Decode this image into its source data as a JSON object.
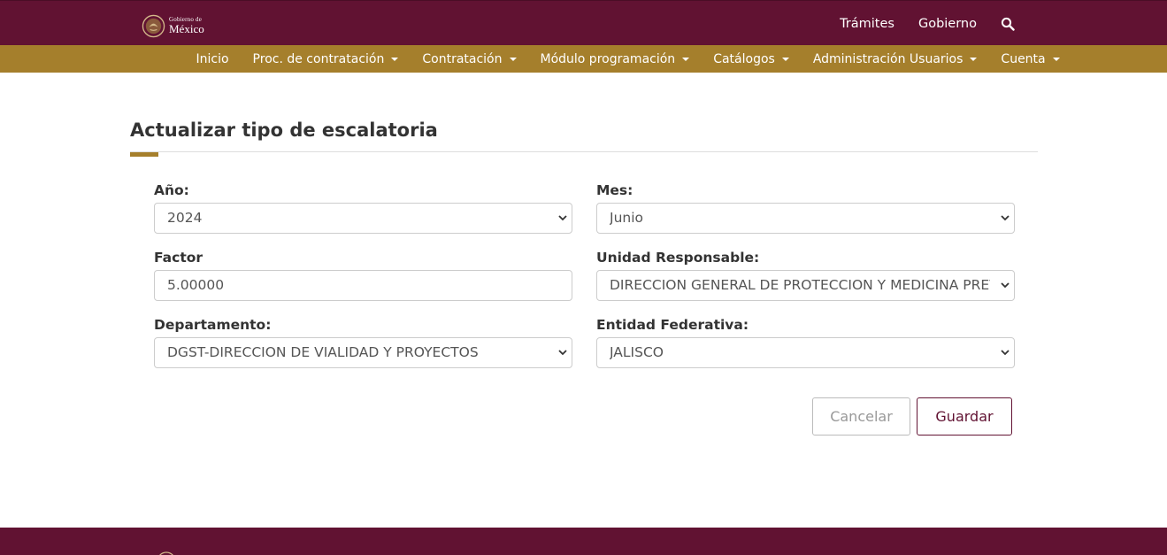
{
  "header": {
    "logo_small": "Gobierno de",
    "logo_big": "México",
    "links": [
      "Trámites",
      "Gobierno"
    ]
  },
  "nav": {
    "items": [
      "Inicio",
      "Proc. de contratación",
      "Contratación",
      "Módulo programación",
      "Catálogos",
      "Administración Usuarios",
      "Cuenta"
    ],
    "has_dropdown": [
      false,
      true,
      true,
      true,
      true,
      true,
      true
    ]
  },
  "page": {
    "title": "Actualizar tipo de escalatoria"
  },
  "form": {
    "anio_label": "Año:",
    "anio_value": "2024",
    "mes_label": "Mes:",
    "mes_value": "Junio",
    "factor_label": "Factor",
    "factor_value": "5.00000",
    "unidad_label": "Unidad Responsable:",
    "unidad_value": "DIRECCION GENERAL DE PROTECCION Y MEDICINA PREVENTIVA",
    "departamento_label": "Departamento:",
    "departamento_value": "DGST-DIRECCION DE VIALIDAD Y PROYECTOS",
    "entidad_label": "Entidad Federativa:",
    "entidad_value": "JALISCO"
  },
  "buttons": {
    "cancel_label": "Cancelar",
    "save_label": "Guardar"
  },
  "colors": {
    "primary": "#611232",
    "accent": "#a57f2c"
  },
  "icons": {
    "logo": "mexico-coat-of-arms-icon",
    "search": "search-icon",
    "dropdown": "chevron-down-icon"
  }
}
